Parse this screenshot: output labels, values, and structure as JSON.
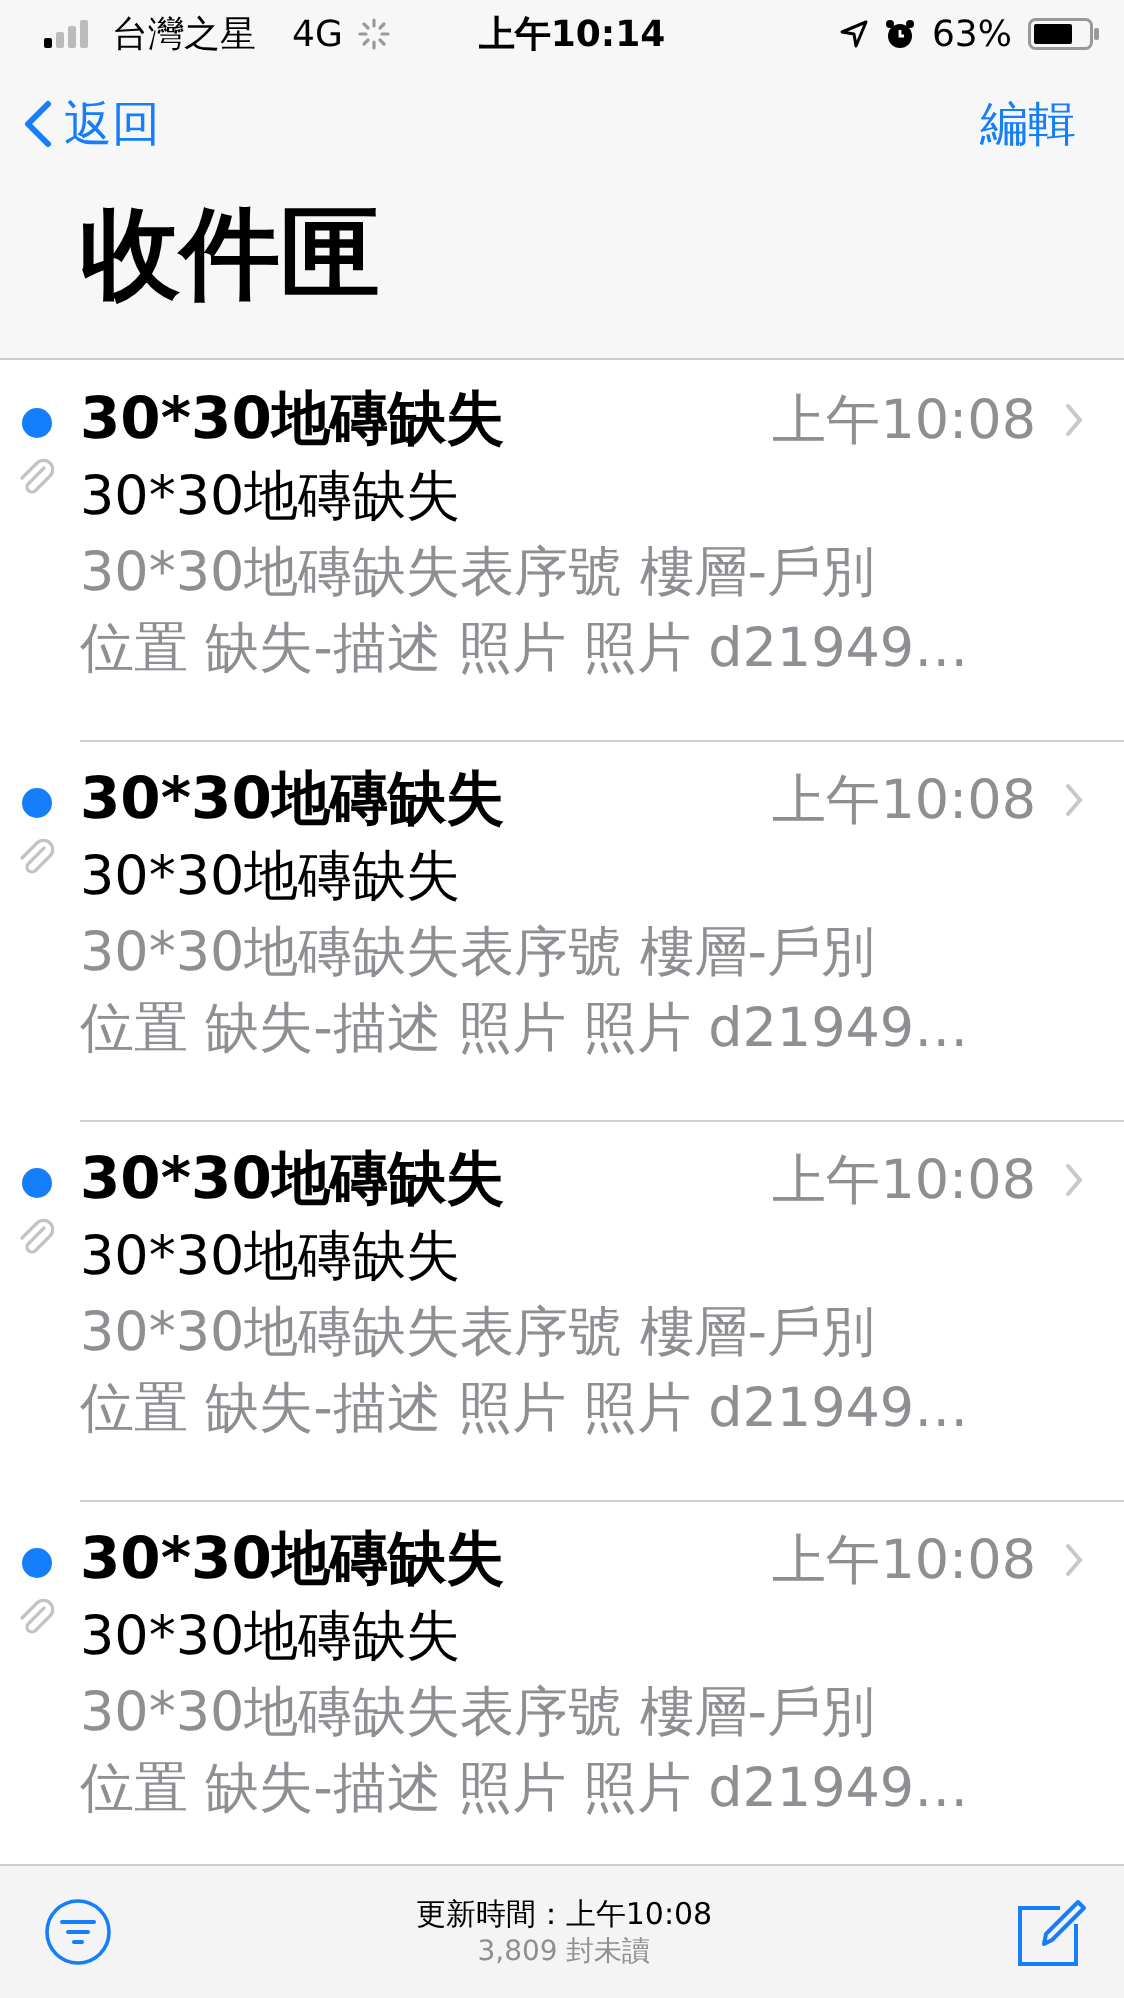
{
  "status_bar": {
    "carrier": "台灣之星",
    "network": "4G",
    "time": "上午10:14",
    "battery": "63%"
  },
  "nav": {
    "back": "返回",
    "edit": "編輯"
  },
  "title": "收件匣",
  "messages": [
    {
      "sender": "30*30地磚缺失",
      "time": "上午10:08",
      "subject": "30*30地磚缺失",
      "preview_lines": [
        "30*30地磚缺失表序號 樓層-戶別",
        "位置 缺失-描述 照片 照片 d21949…"
      ],
      "unread": true,
      "attachment": true
    },
    {
      "sender": "30*30地磚缺失",
      "time": "上午10:08",
      "subject": "30*30地磚缺失",
      "preview_lines": [
        "30*30地磚缺失表序號 樓層-戶別",
        "位置 缺失-描述 照片 照片 d21949…"
      ],
      "unread": true,
      "attachment": true
    },
    {
      "sender": "30*30地磚缺失",
      "time": "上午10:08",
      "subject": "30*30地磚缺失",
      "preview_lines": [
        "30*30地磚缺失表序號 樓層-戶別",
        "位置 缺失-描述 照片 照片 d21949…"
      ],
      "unread": true,
      "attachment": true
    },
    {
      "sender": "30*30地磚缺失",
      "time": "上午10:08",
      "subject": "30*30地磚缺失",
      "preview_lines": [
        "30*30地磚缺失表序號 樓層-戶別",
        "位置 缺失-描述 照片 照片 d21949…"
      ],
      "unread": true,
      "attachment": true
    }
  ],
  "toolbar": {
    "updated": "更新時間：上午10:08",
    "unread_count": "3,809 封未讀"
  }
}
